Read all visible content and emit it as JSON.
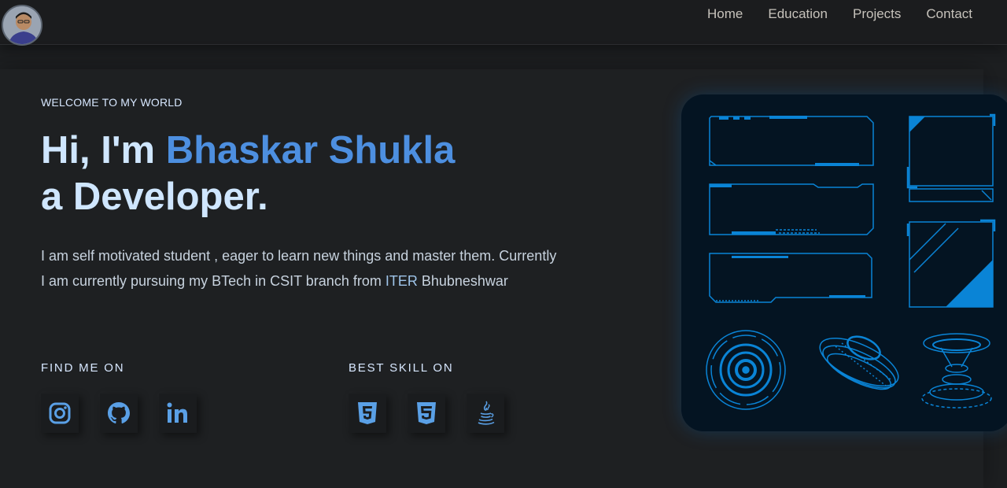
{
  "nav": {
    "links": [
      "Home",
      "Education",
      "Projects",
      "Contact"
    ]
  },
  "hero": {
    "welcome": "WELCOME TO MY WORLD",
    "greeting": "Hi, I'm ",
    "name": "Bhaskar Shukla",
    "role": "a Developer.",
    "intro_1": "I am self motivated student , eager to learn new things and master them. Currently I am currently pursuing my BTech in CSIT branch from ",
    "intro_iter": "ITER",
    "intro_2": " Bhubneshwar",
    "find_label": "FIND ME ON",
    "skill_label": "BEST SKILL ON"
  },
  "icons": {
    "social": [
      "instagram-icon",
      "github-icon",
      "linkedin-icon"
    ],
    "skills": [
      "html5-icon",
      "css3-icon",
      "java-icon"
    ]
  },
  "colors": {
    "accent": "#4d8fe0",
    "heading": "#cfe6ff",
    "icon": "#5aa0e6",
    "hud": "#0a84d6"
  }
}
